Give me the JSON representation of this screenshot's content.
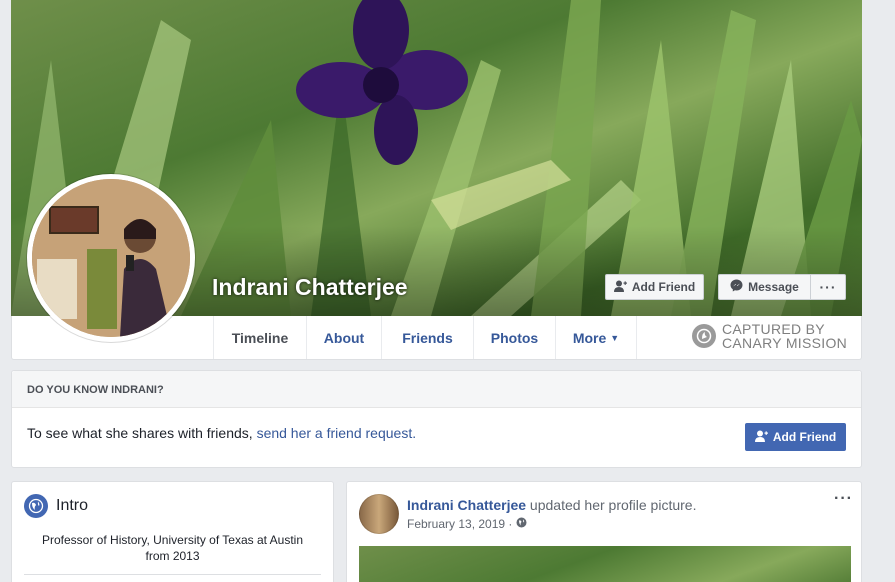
{
  "profile": {
    "name": "Indrani Chatterjee"
  },
  "cover_actions": {
    "add_friend": "Add Friend",
    "message": "Message",
    "more": "···"
  },
  "tabs": [
    {
      "label": "Timeline",
      "active": true
    },
    {
      "label": "About"
    },
    {
      "label": "Friends"
    },
    {
      "label": "Photos"
    },
    {
      "label": "More"
    }
  ],
  "watermark": {
    "line1": "CAPTURED BY",
    "line2": "CANARY MISSION"
  },
  "know_card": {
    "title": "DO YOU KNOW INDRANI?",
    "text": "To see what she shares with friends, ",
    "link": "send her a friend request.",
    "button": "Add Friend"
  },
  "intro": {
    "title": "Intro",
    "text": "Professor of History, University of Texas at Austin from 2013"
  },
  "post": {
    "author": "Indrani Chatterjee",
    "action": " updated her profile picture.",
    "date": "February 13, 2019 ·",
    "more": "···"
  },
  "colors": {
    "link": "#365899",
    "primary": "#4267b2",
    "background": "#e9ebee"
  }
}
